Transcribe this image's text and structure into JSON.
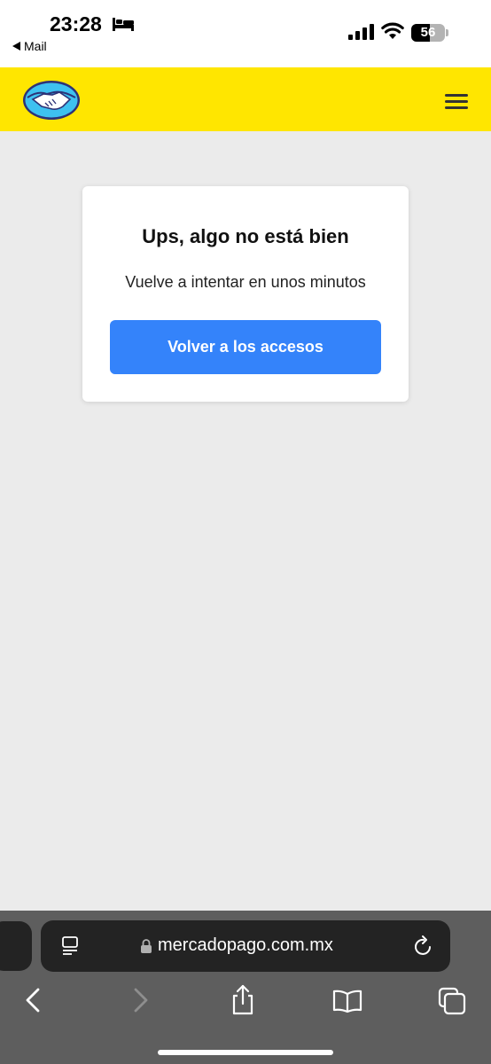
{
  "status_bar": {
    "time": "23:28",
    "back_app": "Mail",
    "battery": 56
  },
  "header": {
    "logo_icon": "handshake-logo-icon",
    "menu_icon": "hamburger-icon"
  },
  "error_card": {
    "title": "Ups, algo no está bien",
    "message": "Vuelve a intentar en unos minutos",
    "button_label": "Volver a los accesos"
  },
  "browser": {
    "url": "mercadopago.com.mx",
    "toolbar": [
      "back-icon",
      "forward-icon",
      "share-icon",
      "bookmarks-icon",
      "tabs-icon"
    ]
  },
  "colors": {
    "header_yellow": "#ffe600",
    "button_blue": "#3483fa",
    "page_background": "#ebebeb"
  }
}
